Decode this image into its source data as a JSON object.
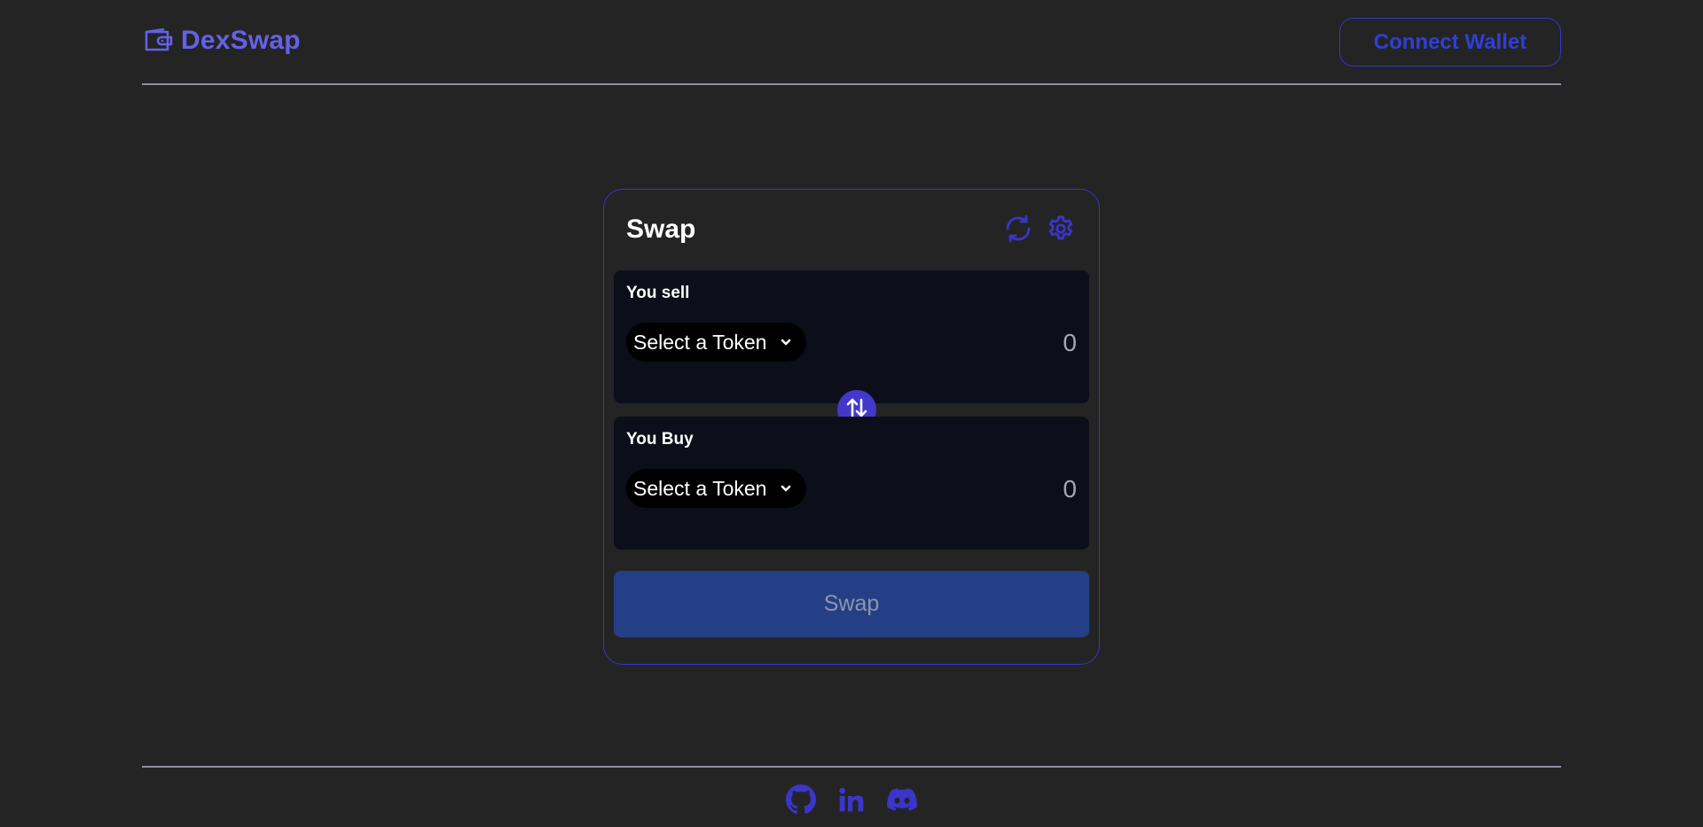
{
  "header": {
    "brand_name": "DexSwap",
    "connect_wallet_label": "Connect Wallet"
  },
  "card": {
    "title": "Swap",
    "sell": {
      "label": "You sell",
      "token_select_label": "Select a Token",
      "amount": "0"
    },
    "buy": {
      "label": "You Buy",
      "token_select_label": "Select a Token",
      "amount": "0"
    },
    "swap_button_label": "Swap"
  },
  "icons": {
    "brand": "wallet-icon",
    "refresh": "refresh-icon",
    "settings": "gear-icon",
    "flip": "swap-arrows-icon",
    "token_dropdown": "chevron-down-icon",
    "social": [
      "github-icon",
      "linkedin-icon",
      "discord-icon"
    ]
  },
  "colors": {
    "background": "#242424",
    "accent": "#4338ca",
    "brand_text": "#6461e8",
    "panel": "#0c0f19",
    "swap_button": "#243f86",
    "divider": "#8f8f9f"
  }
}
